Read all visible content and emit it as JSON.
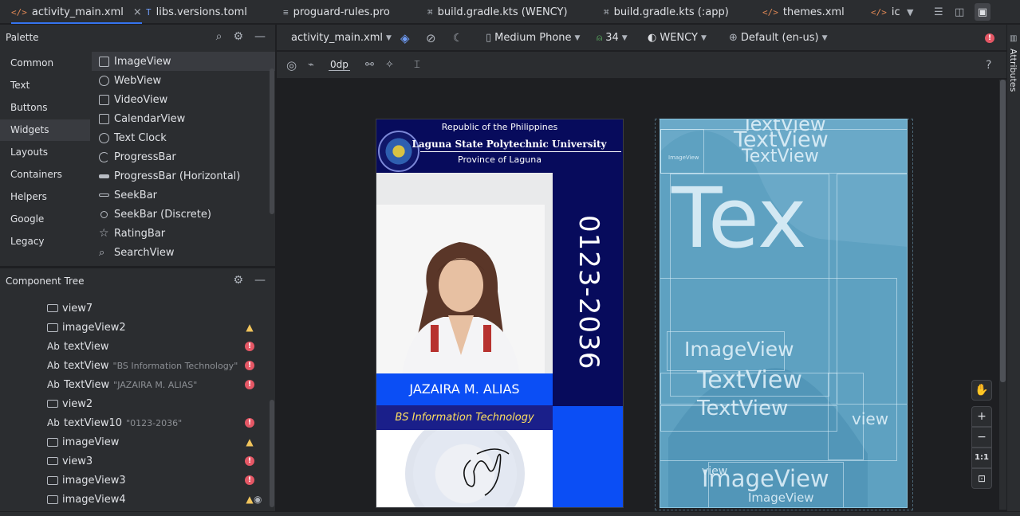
{
  "tabs": [
    {
      "icon": "</>",
      "label": "activity_main.xml",
      "close": "×"
    },
    {
      "icon": "T",
      "label": "libs.versions.toml"
    },
    {
      "icon": "≡",
      "label": "proguard-rules.pro"
    },
    {
      "icon": "⌘",
      "label": "build.gradle.kts (WENCY)"
    },
    {
      "icon": "⌘",
      "label": "build.gradle.kts (:app)"
    },
    {
      "icon": "</>",
      "label": "themes.xml"
    },
    {
      "icon": "</>",
      "label": "ic"
    }
  ],
  "palette": {
    "title": "Palette",
    "categories": [
      "Common",
      "Text",
      "Buttons",
      "Widgets",
      "Layouts",
      "Containers",
      "Helpers",
      "Google",
      "Legacy"
    ],
    "selected_category": "Widgets",
    "widgets": [
      "ImageView",
      "WebView",
      "VideoView",
      "CalendarView",
      "Text Clock",
      "ProgressBar",
      "ProgressBar (Horizontal)",
      "SeekBar",
      "SeekBar (Discrete)",
      "RatingBar",
      "SearchView"
    ]
  },
  "tree": {
    "title": "Component Tree",
    "items": [
      {
        "icon": "view-icon",
        "name": "view7",
        "hint": "",
        "badge": ""
      },
      {
        "icon": "image-icon",
        "name": "imageView2",
        "hint": "",
        "badge": "warn"
      },
      {
        "icon": "text-icon",
        "name": "textView",
        "hint": "",
        "badge": "err"
      },
      {
        "icon": "text-icon",
        "name": "textView",
        "hint": "\"BS Information Technology\"",
        "badge": "err"
      },
      {
        "icon": "text-icon",
        "name": "TextView",
        "hint": "\"JAZAIRA M. ALIAS\"",
        "badge": "err"
      },
      {
        "icon": "view-icon",
        "name": "view2",
        "hint": "",
        "badge": ""
      },
      {
        "icon": "text-icon",
        "name": "textView10",
        "hint": "\"0123-2036\"",
        "badge": "err"
      },
      {
        "icon": "image-icon",
        "name": "imageView",
        "hint": "",
        "badge": "warn"
      },
      {
        "icon": "view-icon",
        "name": "view3",
        "hint": "",
        "badge": "err"
      },
      {
        "icon": "image-icon",
        "name": "imageView3",
        "hint": "",
        "badge": "err"
      },
      {
        "icon": "image-icon",
        "name": "imageView4",
        "hint": "",
        "badge": "warn"
      }
    ],
    "text_prefix": "Ab"
  },
  "toolbar": {
    "file": "activity_main.xml",
    "device": "Medium Phone",
    "api": "34",
    "theme": "WENCY",
    "locale": "Default (en-us)",
    "margin": "0dp"
  },
  "right_strip": {
    "label": "Attributes"
  },
  "card": {
    "header_line1": "Republic of the Philippines",
    "header_line2": "Laguna State Polytechnic University",
    "header_line3": "Province of Laguna",
    "id_number": "0123-2036",
    "name": "JAZAIRA M. ALIAS",
    "course": "BS Information Technology"
  },
  "blueprint": {
    "labels": [
      "TextView",
      "TextView",
      "TextView",
      "ImageView",
      "Tex",
      "ImageView",
      "TextView",
      "TextView",
      "view",
      "ImageView",
      "ImageView",
      "view"
    ]
  },
  "zoom": {
    "one_to_one": "1:1"
  },
  "colors": {
    "accent": "#3574f0",
    "card_navy": "#070b5c",
    "card_blue": "#0b4ef5",
    "blueprint": "#6aa9c8"
  }
}
